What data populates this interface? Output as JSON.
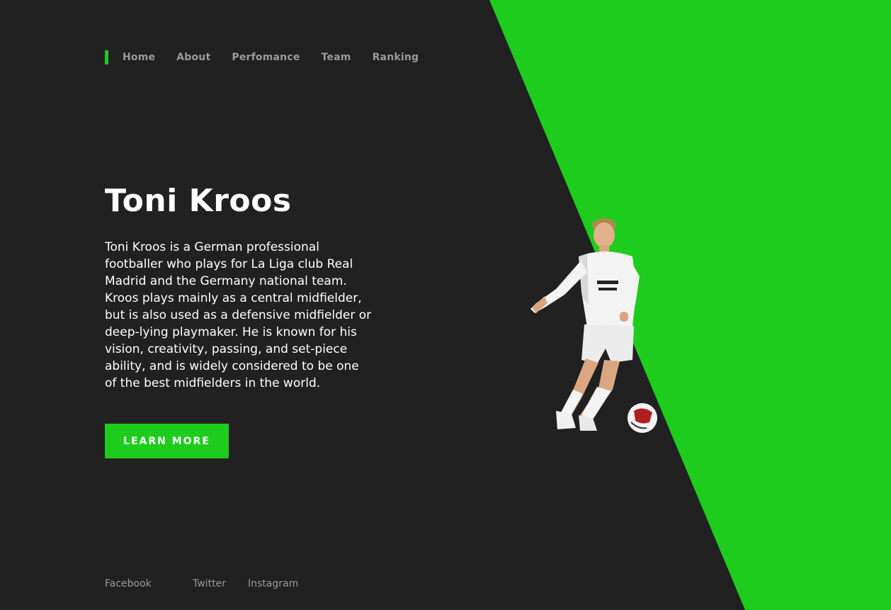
{
  "nav": {
    "items": [
      {
        "label": "Home"
      },
      {
        "label": "About"
      },
      {
        "label": "Perfomance"
      },
      {
        "label": "Team"
      },
      {
        "label": "Ranking"
      }
    ]
  },
  "hero": {
    "title": "Toni Kroos",
    "description": "Toni Kroos is a German professional footballer who plays for La Liga club Real Madrid and the Germany national team. Kroos plays mainly as a central midfielder, but is also used as a defensive midfielder or deep-lying playmaker. He is known for his vision, creativity, passing, and set-piece ability, and is widely considered to be one of the best midfielders in the world.",
    "cta_label": "LEARN MORE"
  },
  "social": {
    "facebook": "Facebook",
    "twitter": "Twitter",
    "instagram": "Instagram"
  },
  "colors": {
    "background": "#212121",
    "accent": "#1ecc1e",
    "text": "#ffffff",
    "muted": "#9a9a9a"
  }
}
